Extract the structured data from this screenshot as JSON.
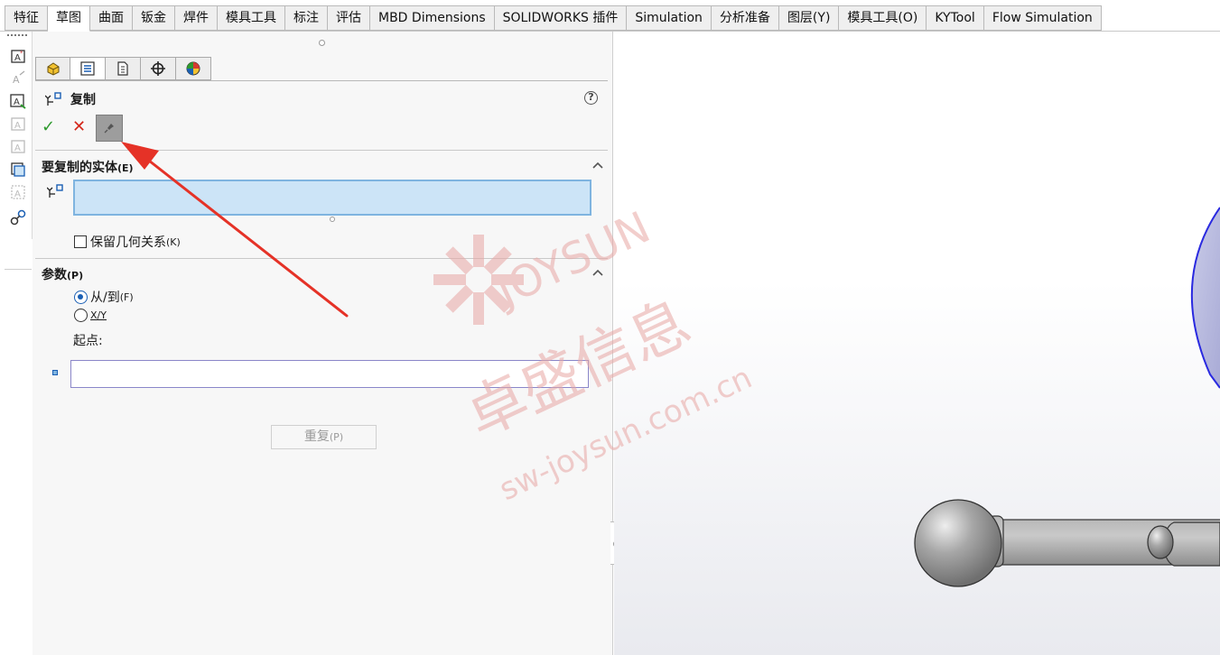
{
  "tabs": [
    {
      "label": "特征",
      "active": false
    },
    {
      "label": "草图",
      "active": true
    },
    {
      "label": "曲面",
      "active": false
    },
    {
      "label": "钣金",
      "active": false
    },
    {
      "label": "焊件",
      "active": false
    },
    {
      "label": "模具工具",
      "active": false
    },
    {
      "label": "标注",
      "active": false
    },
    {
      "label": "评估",
      "active": false
    },
    {
      "label": "MBD Dimensions",
      "active": false
    },
    {
      "label": "SOLIDWORKS 插件",
      "active": false
    },
    {
      "label": "Simulation",
      "active": false
    },
    {
      "label": "分析准备",
      "active": false
    },
    {
      "label": "图层(Y)",
      "active": false
    },
    {
      "label": "模具工具(O)",
      "active": false
    },
    {
      "label": "KYTool",
      "active": false
    },
    {
      "label": "Flow Simulation",
      "active": false
    }
  ],
  "property_manager": {
    "title": "复制",
    "help": "?",
    "ok": "✓",
    "cancel": "✕",
    "entities_section": {
      "title": "要复制的实体",
      "shortcut": "(E)",
      "keep_relations_label": "保留几何关系",
      "keep_relations_shortcut": "(K)",
      "keep_relations_checked": false
    },
    "params_section": {
      "title": "参数",
      "shortcut": "(P)",
      "option_from_to": "从/到",
      "option_from_to_shortcut": "(F)",
      "option_xy": "X/Y",
      "selected": "from_to",
      "start_point_label": "起点:",
      "repeat_button": "重复",
      "repeat_shortcut": "(P)"
    }
  },
  "watermark": {
    "brand": "JOYSUN",
    "name_cn": "卓盛信息",
    "site": "sw-joysun.com.cn",
    "color": "#e8a7a4"
  },
  "colors": {
    "arrow": "#e53227",
    "selection_fill": "#cce4f7",
    "sketch_blue": "#2a2ae0"
  }
}
